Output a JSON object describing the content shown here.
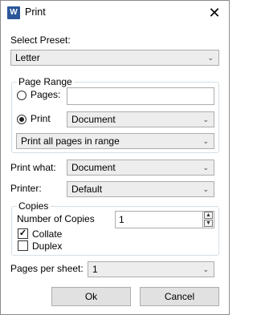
{
  "window": {
    "title": "Print",
    "app_icon_letter": "W"
  },
  "preset": {
    "label": "Select Preset:",
    "value": "Letter"
  },
  "page_range": {
    "title": "Page Range",
    "pages_label": "Pages:",
    "pages_value": "",
    "print_label": "Print",
    "print_value": "Document",
    "range_value": "Print all pages in range"
  },
  "print_what": {
    "label": "Print what:",
    "value": "Document"
  },
  "printer": {
    "label": "Printer:",
    "value": "Default"
  },
  "copies": {
    "title": "Copies",
    "number_label": "Number of Copies",
    "number_value": "1",
    "collate_label": "Collate",
    "collate_checked": true,
    "duplex_label": "Duplex",
    "duplex_checked": false
  },
  "pages_per_sheet": {
    "label": "Pages per sheet:",
    "value": "1"
  },
  "buttons": {
    "ok": "Ok",
    "cancel": "Cancel"
  }
}
